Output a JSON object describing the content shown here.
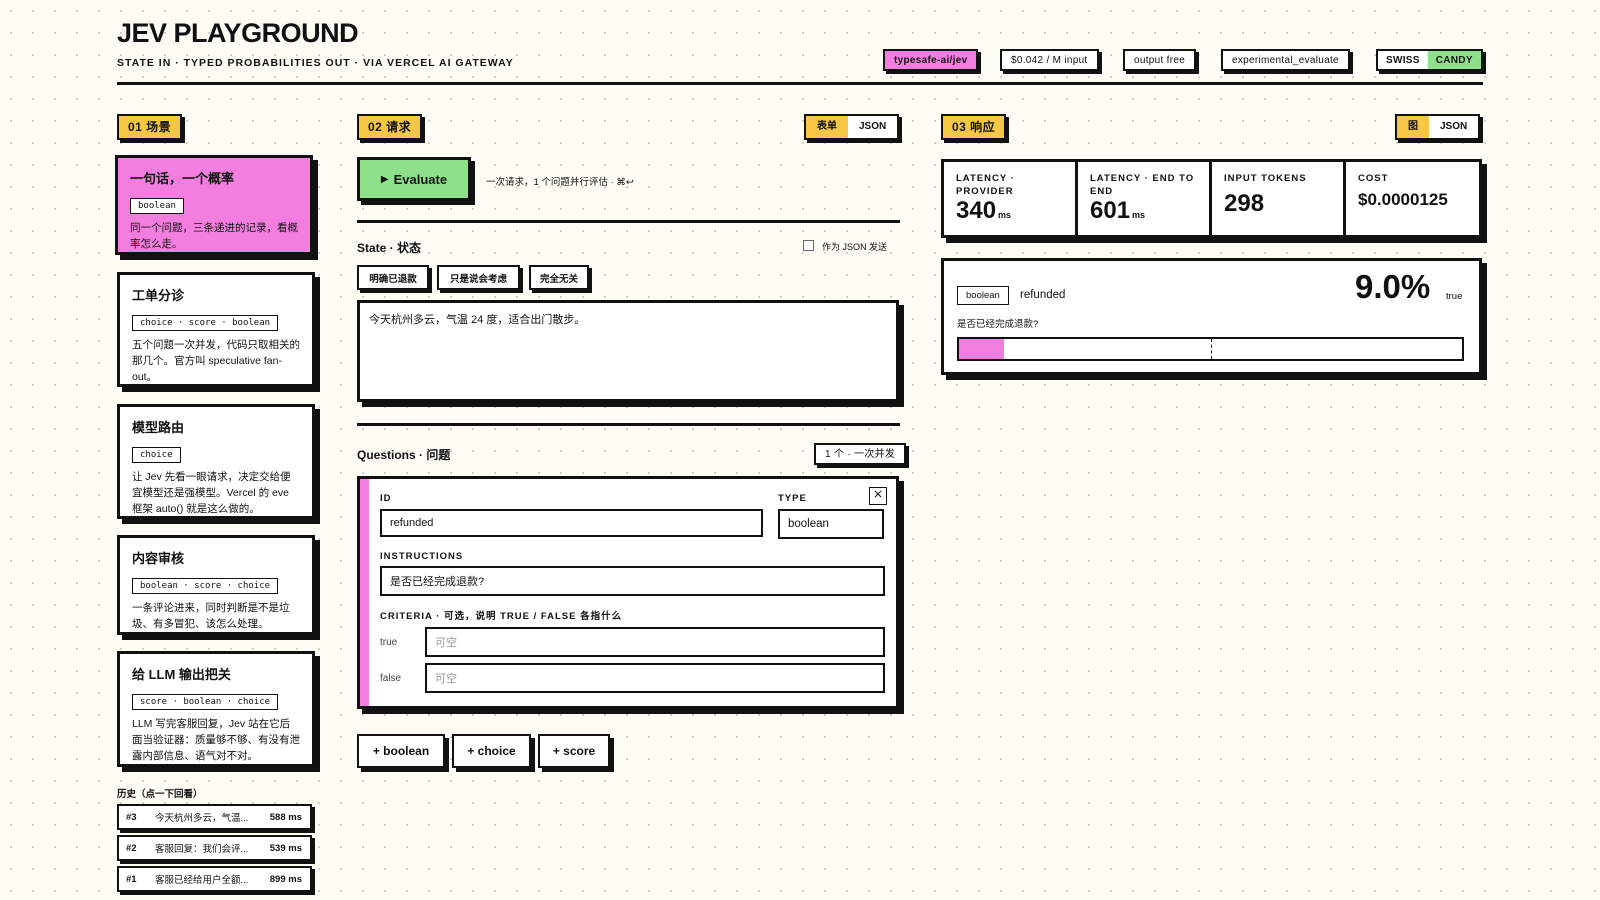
{
  "header": {
    "title": "JEV PLAYGROUND",
    "subtitle": "STATE IN · TYPED PROBABILITIES OUT · VIA VERCEL AI GATEWAY",
    "tags": [
      "typesafe-ai/jev",
      "$0.042 / M input",
      "output free",
      "experimental_evaluate"
    ],
    "theme_left": "SWISS",
    "theme_right": "CANDY"
  },
  "scenarios": {
    "badge": "01 场景",
    "items": [
      {
        "title": "一句话，一个概率",
        "chip": "boolean",
        "desc": "同一个问题，三条递进的记录，看概率怎么走。"
      },
      {
        "title": "工单分诊",
        "chip": "choice · score · boolean",
        "desc": "五个问题一次并发，代码只取相关的那几个。官方叫 speculative fan-out。"
      },
      {
        "title": "模型路由",
        "chip": "choice",
        "desc": "让 Jev 先看一眼请求，决定交给便宜模型还是强模型。Vercel 的 eve 框架 auto() 就是这么做的。"
      },
      {
        "title": "内容审核",
        "chip": "boolean · score · choice",
        "desc": "一条评论进来，同时判断是不是垃圾、有多冒犯、该怎么处理。"
      },
      {
        "title": "给 LLM 输出把关",
        "chip": "score · boolean · choice",
        "desc": "LLM 写完客服回复，Jev 站在它后面当验证器：质量够不够、有没有泄露内部信息、语气对不对。"
      }
    ],
    "history_label": "历史（点一下回看）",
    "history": [
      {
        "n": "#3",
        "text": "今天杭州多云，气温...",
        "ms": "588 ms"
      },
      {
        "n": "#2",
        "text": "客服回复：我们会评...",
        "ms": "539 ms"
      },
      {
        "n": "#1",
        "text": "客服已经给用户全额...",
        "ms": "899 ms"
      }
    ]
  },
  "request": {
    "badge": "02 请求",
    "toggle": [
      "表单",
      "JSON"
    ],
    "evaluate_label": "Evaluate",
    "evaluate_hint": "一次请求，1 个问题并行评估 · ⌘↩",
    "state_title": "State · 状态",
    "send_as_json": "作为 JSON 发送",
    "presets": [
      "明确已退款",
      "只是说会考虑",
      "完全无关"
    ],
    "state_text": "今天杭州多云，气温 24 度，适合出门散步。",
    "questions_title": "Questions · 问题",
    "questions_count": "1 个 · 一次并发",
    "question": {
      "id_label": "ID",
      "id_value": "refunded",
      "type_label": "TYPE",
      "type_value": "boolean",
      "close": "×",
      "instructions_label": "INSTRUCTIONS",
      "instructions_value": "是否已经完成退款?",
      "criteria_label": "CRITERIA · 可选，说明 TRUE / FALSE 各指什么",
      "true_label": "true",
      "false_label": "false",
      "placeholder": "可空"
    },
    "add_buttons": [
      "+ boolean",
      "+ choice",
      "+ score"
    ]
  },
  "response": {
    "badge": "03 响应",
    "toggle": [
      "图",
      "JSON"
    ],
    "metrics": [
      {
        "key": "LATENCY · PROVIDER",
        "value": "340",
        "unit": "ms"
      },
      {
        "key": "LATENCY · END TO END",
        "value": "601",
        "unit": "ms"
      },
      {
        "key": "INPUT TOKENS",
        "value": "298",
        "unit": ""
      },
      {
        "key": "COST",
        "value": "$0.0000125",
        "unit": ""
      }
    ],
    "result": {
      "type": "boolean",
      "id": "refunded",
      "question": "是否已经完成退款?",
      "probability_text": "9.0%",
      "probability": 0.09,
      "outcome": "true"
    }
  },
  "colors": {
    "pink": "#f47ee0",
    "yellow": "#f6c744",
    "green": "#8fe08a",
    "ink": "#111111"
  }
}
